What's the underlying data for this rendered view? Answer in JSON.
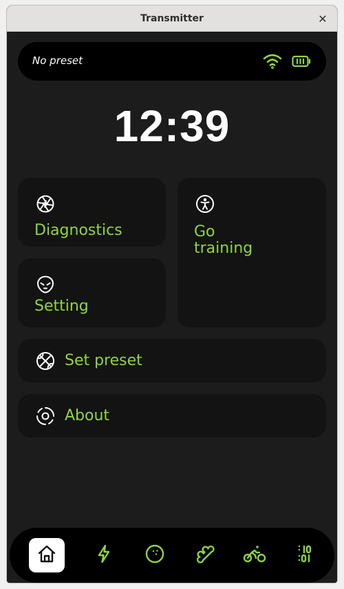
{
  "window": {
    "title": "Transmitter",
    "close_glyph": "✕"
  },
  "status": {
    "preset": "No preset",
    "wifi_icon": "wifi-icon",
    "battery_icon": "battery-icon"
  },
  "clock": "12:39",
  "tiles": {
    "diagnostics": {
      "label": "Diagnostics",
      "icon": "aperture-icon"
    },
    "go_training": {
      "label_line1": "Go",
      "label_line2": "training",
      "icon": "accessibility-icon"
    },
    "setting": {
      "label": "Setting",
      "icon": "alien-icon"
    }
  },
  "rows": {
    "set_preset": {
      "label": "Set preset",
      "icon": "basketball-icon"
    },
    "about": {
      "label": "About",
      "icon": "circle-dashed-icon"
    }
  },
  "nav": [
    {
      "name": "home",
      "icon": "home-icon",
      "active": true
    },
    {
      "name": "power",
      "icon": "bolt-icon",
      "active": false
    },
    {
      "name": "ball",
      "icon": "ball-icon",
      "active": false
    },
    {
      "name": "bone",
      "icon": "bone-icon",
      "active": false
    },
    {
      "name": "bike",
      "icon": "bike-icon",
      "active": false
    },
    {
      "name": "binary",
      "icon": "binary-icon",
      "active": false
    }
  ],
  "colors": {
    "accent": "#8ed63f",
    "background": "#1c1c1c",
    "tile": "#131313",
    "bar": "#000000"
  }
}
